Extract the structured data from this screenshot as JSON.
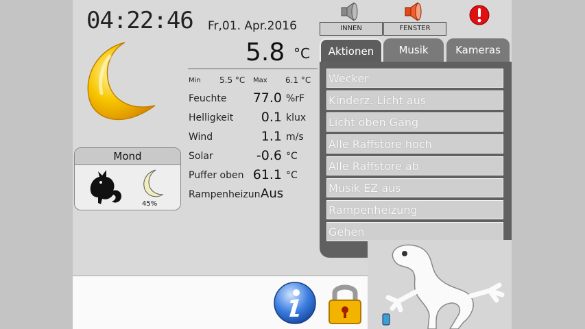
{
  "clock": {
    "time": "04:22:46"
  },
  "date": {
    "text": "Fr,01. Apr.2016"
  },
  "weather": {
    "temperature": "5.8",
    "temperature_unit": "°C",
    "min_label": "Min",
    "min_value": "5.5 °C",
    "max_label": "Max",
    "max_value": "6.1 °C",
    "rows": [
      {
        "label": "Feuchte",
        "value": "77.0",
        "unit": "%rF"
      },
      {
        "label": "Helligkeit",
        "value": "0.1",
        "unit": "klux"
      },
      {
        "label": "Wind",
        "value": "1.1",
        "unit": "m/s"
      },
      {
        "label": "Solar",
        "value": "-0.6",
        "unit": "°C"
      },
      {
        "label": "Puffer oben",
        "value": "61.1",
        "unit": "°C"
      },
      {
        "label": "Rampenheizun",
        "value": "Aus",
        "unit": ""
      }
    ]
  },
  "mond": {
    "title": "Mond",
    "phase_percent": "45%",
    "sign_icon": "capricorn-icon",
    "phase_icon": "moon-phase-icon"
  },
  "top_buttons": {
    "innen": "INNEN",
    "fenster": "FENSTER"
  },
  "tabs": [
    "Aktionen",
    "Musik",
    "Kameras"
  ],
  "actions": [
    "Wecker",
    "Kinderz. Licht aus",
    "Licht oben Gang",
    "Alle Raffstore hoch",
    "Alle Raffstore ab",
    "Musik EZ aus",
    "Rampenheizung",
    "Gehen"
  ],
  "icons": {
    "weather": "crescent-moon-icon",
    "speaker_grey": "speaker-icon",
    "speaker_red": "speaker-alarm-icon",
    "alert": "alert-icon",
    "info": "info-icon",
    "lock": "lock-icon",
    "mascot": "gecko-icon"
  },
  "colors": {
    "screen_bg": "#d9d9d9",
    "panel_bg": "#606060",
    "moon_yellow": "#f5c400",
    "alert_red": "#e01010"
  }
}
